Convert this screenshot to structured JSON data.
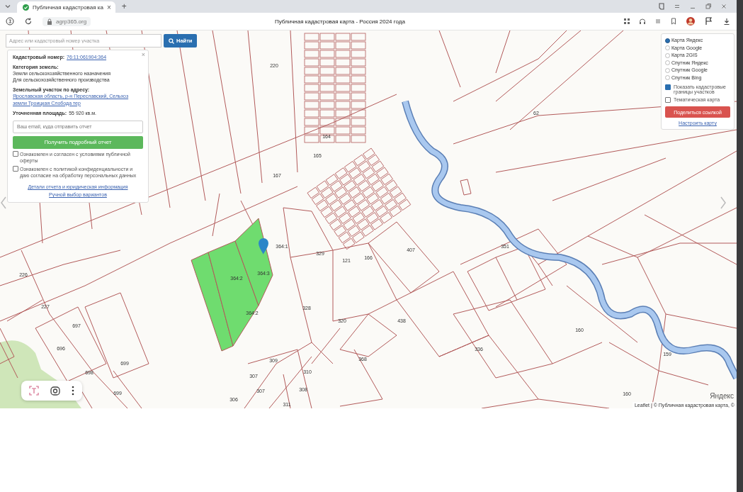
{
  "browser": {
    "tabs": [
      {
        "title": "Публичная кадастровая ка",
        "close": "×",
        "selected": true
      }
    ],
    "new_tab": "+",
    "url": "agrp365.org",
    "page_title": "Публичная кадастровая карта - Россия 2024 года"
  },
  "search": {
    "placeholder": "Адрес или кадастровый номер участка",
    "button": "Найти"
  },
  "info_panel": {
    "close": "×",
    "fields": [
      {
        "label": "Кадастровый номер:",
        "value": "76:11:061904:364",
        "kind": "link"
      },
      {
        "label": "Категория земель:",
        "value": "Земли сельскохозяйственного назначения",
        "note": "Для сельскохозяйственного производства",
        "kind": "text"
      },
      {
        "label": "Земельный участок по адресу:",
        "value": "Ярославская область, р-н Переславский, Сельхоз земли Троицкая Слобода тер",
        "kind": "link"
      },
      {
        "label": "Уточненная площадь:",
        "value": "55 920 кв.м.",
        "kind": "text"
      }
    ],
    "email_placeholder": "Ваш email, куда отправить отчет",
    "submit": "Получить подробный отчет",
    "agreements": [
      {
        "text": "Ознакомлен и согласен с условиями публичной оферты",
        "checked": false
      },
      {
        "text": "Ознакомлен с политикой конфиденциальности и даю согласие на обработку персональных данных",
        "checked": false
      }
    ],
    "links": [
      "Детали отчета и юридическая информация",
      "Ручной выбор вариантов"
    ]
  },
  "layers": {
    "base": [
      {
        "label": "Карта Яндекс",
        "selected": true
      },
      {
        "label": "Карта Google",
        "selected": false
      },
      {
        "label": "Карта 2GIS",
        "selected": false
      },
      {
        "label": "Спутник Яндекс",
        "selected": false
      },
      {
        "label": "Спутник Google",
        "selected": false
      },
      {
        "label": "Спутник Bing",
        "selected": false
      }
    ],
    "options": [
      {
        "label": "Показать кадастровые границы участков",
        "checked": true
      },
      {
        "label": "Тематическая карта",
        "checked": false
      }
    ],
    "share": "Поделиться ссылкой",
    "configure": "Настроить карту"
  },
  "map": {
    "parcel_labels": [
      "220",
      "62",
      "164",
      "165",
      "167",
      "329",
      "121",
      "166",
      "407",
      "351",
      "226",
      "227",
      "697",
      "696",
      "698",
      "699",
      "699",
      "328",
      "320",
      "438",
      "336",
      "160",
      "159",
      "160",
      "309",
      "310",
      "307",
      "307",
      "308",
      "306",
      "311",
      "368",
      "364:1",
      "364:3",
      "364:2",
      "364:2"
    ],
    "logo": "Яндекс",
    "attribution": "Leaflet | © Публичная кадастровая карта, ©"
  }
}
